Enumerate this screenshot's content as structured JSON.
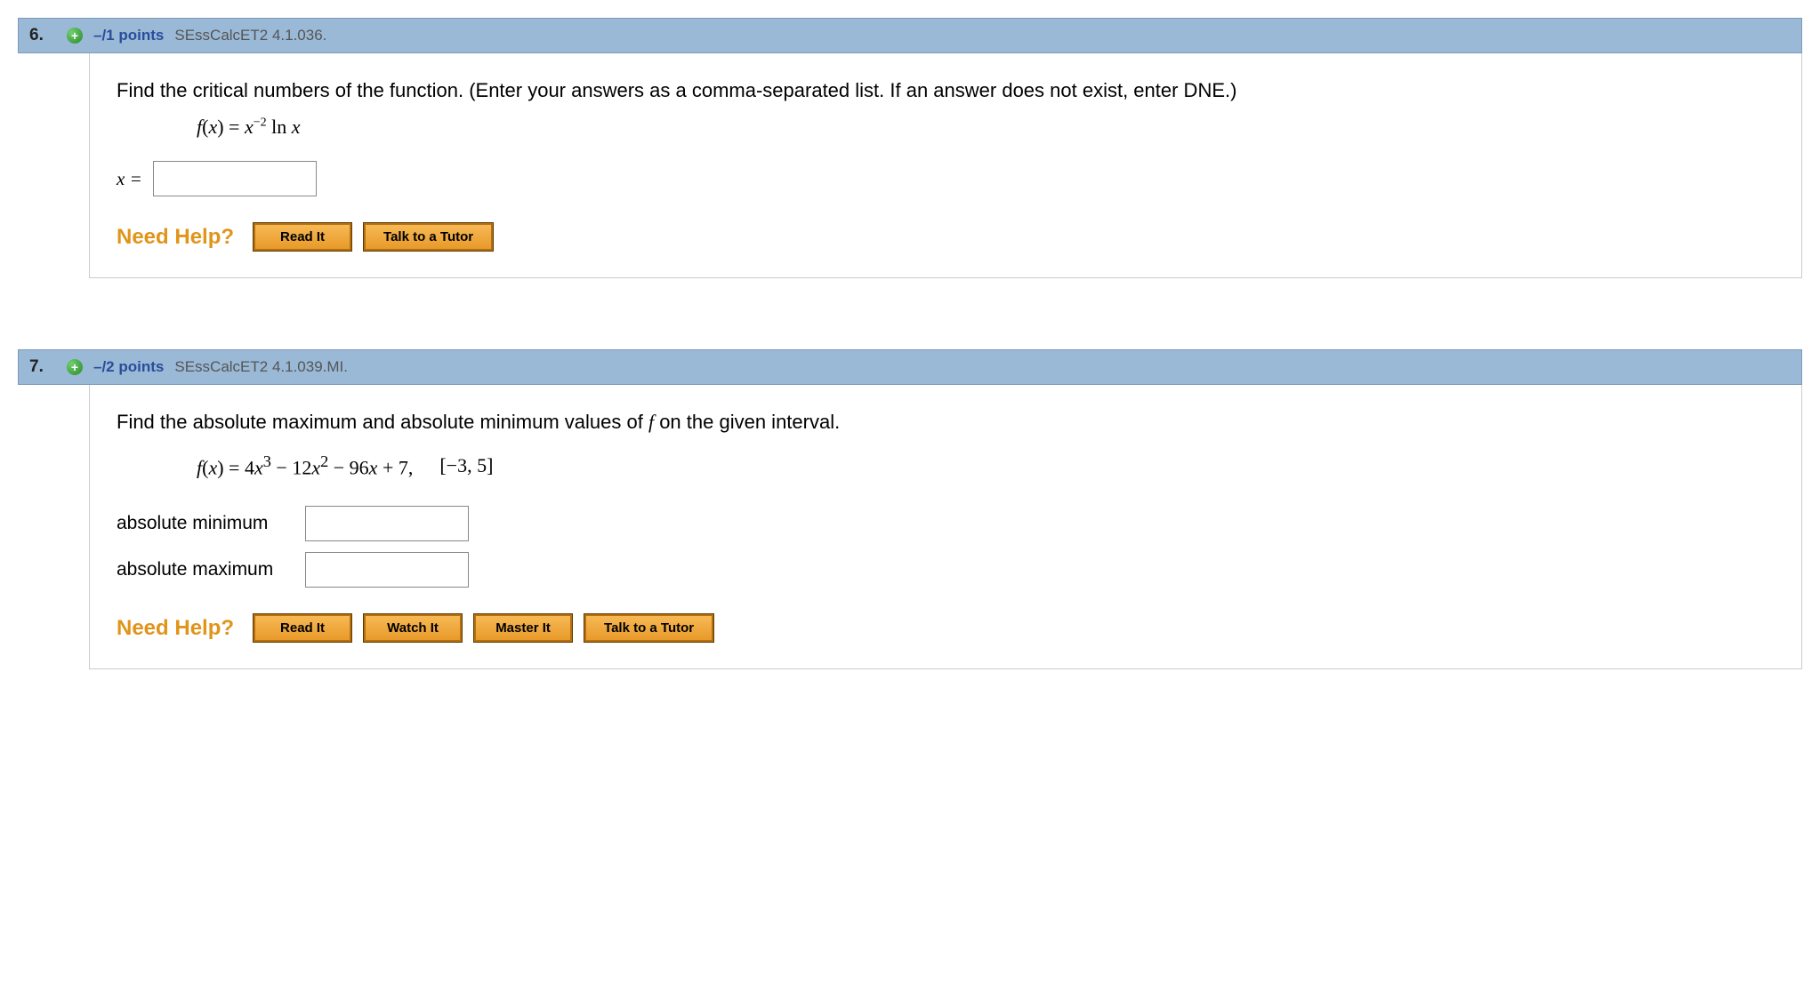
{
  "q6": {
    "number": "6.",
    "points": "–/1 points",
    "source": "SEssCalcET2 4.1.036.",
    "prompt": "Find the critical numbers of the function. (Enter your answers as a comma-separated list. If an answer does not exist, enter DNE.)",
    "answer_label": "x =",
    "need_help": "Need Help?",
    "buttons": {
      "read": "Read It",
      "tutor": "Talk to a Tutor"
    }
  },
  "q7": {
    "number": "7.",
    "points": "–/2 points",
    "source": "SEssCalcET2 4.1.039.MI.",
    "prompt": "Find the absolute maximum and absolute minimum values of f on the given interval.",
    "interval_prefix": "[−",
    "interval_a": "3",
    "interval_mid": ", ",
    "interval_b": "5",
    "interval_suffix": "]",
    "coef_b": "12",
    "coef_c": "96",
    "coef_d": "7",
    "abs_min_label": "absolute minimum",
    "abs_max_label": "absolute maximum",
    "need_help": "Need Help?",
    "buttons": {
      "read": "Read It",
      "watch": "Watch It",
      "master": "Master It",
      "tutor": "Talk to a Tutor"
    }
  }
}
